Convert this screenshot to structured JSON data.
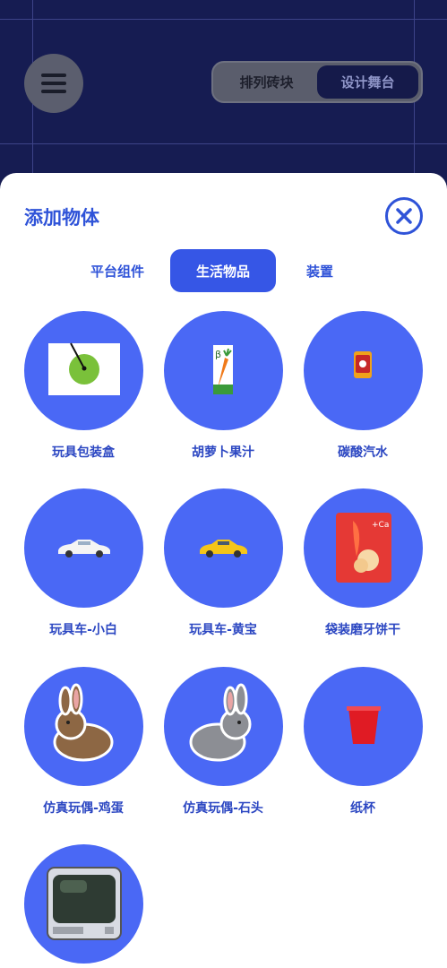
{
  "header": {
    "menu_icon": "hamburger-menu-icon",
    "segments": [
      {
        "label": "排列砖块",
        "active": false
      },
      {
        "label": "设计舞台",
        "active": true
      }
    ]
  },
  "sheet": {
    "title": "添加物体",
    "close_icon": "close-circle-icon",
    "tabs": [
      {
        "label": "平台组件",
        "active": false
      },
      {
        "label": "生活物品",
        "active": true
      },
      {
        "label": "装置",
        "active": false
      }
    ],
    "items": [
      {
        "label": "玩具包装盒",
        "icon": "toy-box-icon"
      },
      {
        "label": "胡萝卜果汁",
        "icon": "carrot-juice-icon"
      },
      {
        "label": "碳酸汽水",
        "icon": "soda-can-icon"
      },
      {
        "label": "玩具车-小白",
        "icon": "white-car-icon"
      },
      {
        "label": "玩具车-黄宝",
        "icon": "yellow-car-icon"
      },
      {
        "label": "袋装磨牙饼干",
        "icon": "biscuit-bag-icon"
      },
      {
        "label": "仿真玩偶-鸡蛋",
        "icon": "brown-rabbit-icon"
      },
      {
        "label": "仿真玩偶-石头",
        "icon": "gray-rabbit-icon"
      },
      {
        "label": "纸杯",
        "icon": "paper-cup-icon"
      },
      {
        "label": "",
        "icon": "tv-icon"
      }
    ]
  },
  "colors": {
    "background": "#171d52",
    "accent": "#3656e6",
    "circle": "#4a68f5",
    "label": "#2c47c2"
  }
}
